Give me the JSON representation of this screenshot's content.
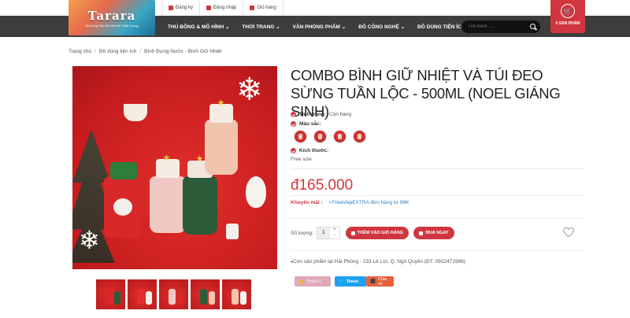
{
  "top_links": [
    {
      "icon": "edit-icon",
      "label": "Đăng ký"
    },
    {
      "icon": "user-icon",
      "label": "Đăng nhập"
    },
    {
      "icon": "cart-icon",
      "label": "Giỏ hàng"
    }
  ],
  "logo": {
    "text": "Tarara",
    "tagline": "Đồ Dùng Tiện Ích Giá Rẻ Chất Lượng"
  },
  "nav": [
    {
      "label": "THÚ BÔNG & MÔ HÌNH"
    },
    {
      "label": "THỜI TRANG"
    },
    {
      "label": "VĂN PHÒNG PHẨM"
    },
    {
      "label": "ĐỒ CÔNG NGHỆ"
    },
    {
      "label": "ĐỒ DÙNG TIỆN ÍCH"
    }
  ],
  "search": {
    "placeholder": "Tìm kiếm ....",
    "icon": "search-icon"
  },
  "cart": {
    "label": "0 SẢN PHẨM",
    "icon": "cart-icon"
  },
  "breadcrumb": [
    "Trang chủ",
    "Đồ dùng tiện ích",
    "Bình Đựng Nước - Bình Giữ Nhiệt"
  ],
  "product": {
    "title": "COMBO BÌNH GIỮ NHIỆT VÀ TÚI ĐEO SỪNG TUẦN LỘC - 500ML (NOEL GIÁNG SINH)",
    "status_label": "Tình trạng:",
    "status_value": "Còn hàng",
    "color_label": "Màu sắc:",
    "size_label": "Kích thước:",
    "size_value": "Free size",
    "price": "đ165.000",
    "promo_label": "Khuyến mãi :",
    "promo_value": "FreeshipEXTRA đơn hàng từ 99K",
    "qty_label": "Số lượng:",
    "qty_value": "1",
    "qty_plus": "+",
    "qty_minus": "-",
    "add_to_cart": "THÊM VÀO GIỎ HÀNG",
    "buy_now": "MUA NGAY",
    "store": "Còn sản phẩm tại Hải Phòng - 233 Lê Lợi, Q. Ngô Quyền (ĐT: 0922471988)"
  },
  "social": {
    "like": "Thích 0",
    "tweet": "Tweet",
    "share": "Chia sẻ"
  },
  "colors": {
    "accent": "#d0363f",
    "nav_bg": "#3d3d3d",
    "link": "#2a7dc2"
  }
}
